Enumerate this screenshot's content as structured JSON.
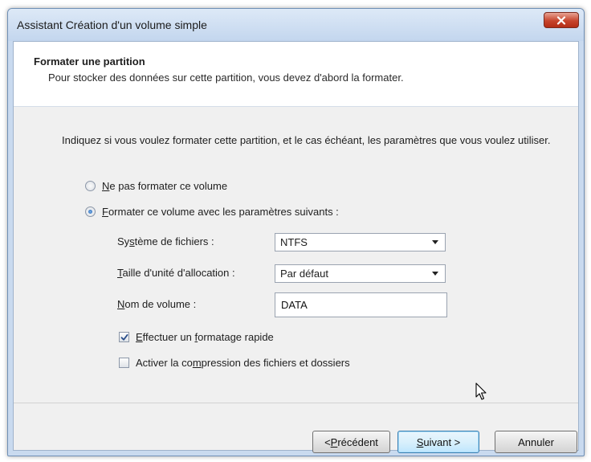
{
  "window": {
    "title": "Assistant Création d'un volume simple"
  },
  "header": {
    "title": "Formater une partition",
    "subtitle": "Pour stocker des données sur cette partition, vous devez d'abord la formater."
  },
  "body": {
    "intro": "Indiquez si vous voulez formater cette partition, et le cas échéant, les paramètres que vous voulez utiliser.",
    "radio_no_format": {
      "accel": "N",
      "rest": "e pas formater ce volume",
      "checked": false
    },
    "radio_format": {
      "accel": "F",
      "rest": "ormater ce volume avec les paramètres suivants :",
      "checked": true
    },
    "filesystem": {
      "pre": "Sy",
      "accel": "s",
      "post": "tème de fichiers :",
      "value": "NTFS"
    },
    "allocation": {
      "pre": "",
      "accel": "T",
      "post": "aille d'unité d'allocation :",
      "value": "Par défaut"
    },
    "volume_name": {
      "pre": "",
      "accel": "N",
      "post": "om de volume :",
      "value": "DATA"
    },
    "quick_format": {
      "accel": "E",
      "post": "ffectuer un ",
      "accel2": "f",
      "post2": "ormatage rapide",
      "checked": true
    },
    "compression": {
      "pre": "Activer la co",
      "accel": "m",
      "post": "pression des fichiers et dossiers",
      "checked": false
    }
  },
  "buttons": {
    "back": {
      "pre": "< ",
      "accel": "P",
      "post": "récédent"
    },
    "next": {
      "pre": "",
      "accel": "S",
      "post": "uivant >"
    },
    "cancel": {
      "label": "Annuler"
    }
  },
  "icons": {
    "close": "close-icon",
    "cursor": "mouse-pointer-icon"
  },
  "colors": {
    "close_button": "#c7452d",
    "default_button_border": "#3c7fb1",
    "title_bar": "#c9daef"
  }
}
